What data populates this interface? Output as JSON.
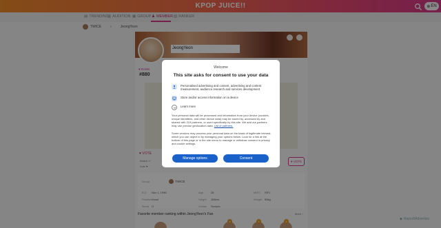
{
  "header": {
    "brand": "KPOP JUICE!!",
    "lang_label": "EN"
  },
  "nav": [
    {
      "label": "TRENDING",
      "active": false
    },
    {
      "label": "AUDITION",
      "active": false
    },
    {
      "label": "GROUP",
      "active": false
    },
    {
      "label": "MEMBER",
      "active": true
    },
    {
      "label": "RANKER",
      "active": false
    }
  ],
  "breadcrumb": {
    "group": "TWICE",
    "separator": "›",
    "member": "JeongYeon"
  },
  "profile": {
    "name": "JeongYeon",
    "rank_label": "♥ RANK",
    "rank_value": "#880",
    "vote_label": "♥ VOTE",
    "vote_button": "♥ VOTE",
    "meta_1": "Watch 🗊",
    "meta_2": "Vote ♥",
    "info": {
      "group_label": "Group",
      "group_value": "TWICE",
      "birth_label": "B.D",
      "birth_value": "Nov 1, 1996",
      "age_label": "Age",
      "age_value": "28",
      "mbti_label": "MBTI",
      "mbti_value": "ISFJ",
      "position_label": "Position",
      "position_value": "Vocal",
      "height_label": "Height",
      "height_value": "168cm",
      "weight_label": "Weight",
      "weight_value": "50kg",
      "blood_label": "Blood",
      "blood_value": "O",
      "zodiac_label": "Zodiac",
      "zodiac_value": "Scorpio"
    },
    "ranking_title": "Favorite member ranking within JeongYeon's Fan",
    "more_label": "More ›",
    "mini_badges": [
      "4",
      "5",
      "6"
    ]
  },
  "watermark": "Report/Advertise",
  "consent": {
    "welcome": "Welcome",
    "title": "This site asks for consent to use your data",
    "items": [
      {
        "icon": "person-icon",
        "text": "Personalised advertising and content, advertising and content measurement, audience research and services development"
      },
      {
        "icon": "device-icon",
        "text": "Store and/or access information on a device"
      },
      {
        "icon": "chevron-down-icon",
        "text": "Learn more"
      }
    ],
    "para1": "Your personal data will be processed and information from your device (cookies, unique identifiers, and other device data) may be stored by, accessed by and shared with 219 partners, or used specifically by this site. We and our partners may use precise geolocation data.",
    "para1_link": "List of partners.",
    "para2": "Some vendors may process your personal data on the basis of legitimate interest, which you can object to by managing your options below. Look for a link at the bottom of this page or in the site menu to manage or withdraw consent in privacy and cookie settings.",
    "manage_label": "Manage options",
    "consent_label": "Consent"
  },
  "colors": {
    "accent": "#d63a8a",
    "button": "#1a62c9"
  }
}
